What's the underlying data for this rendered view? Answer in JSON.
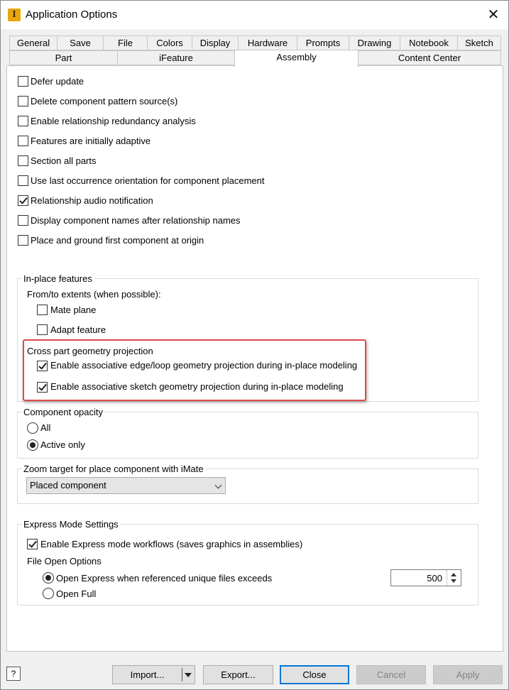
{
  "window": {
    "title": "Application Options",
    "app_icon_letter": "I"
  },
  "tabs": {
    "row1": [
      "General",
      "Save",
      "File",
      "Colors",
      "Display",
      "Hardware",
      "Prompts",
      "Drawing",
      "Notebook",
      "Sketch"
    ],
    "row2": [
      "Part",
      "iFeature",
      "Assembly",
      "Content Center"
    ],
    "active": "Assembly"
  },
  "options": [
    {
      "label": "Defer update",
      "checked": false
    },
    {
      "label": "Delete component pattern source(s)",
      "checked": false
    },
    {
      "label": "Enable relationship redundancy analysis",
      "checked": false
    },
    {
      "label": "Features are initially adaptive",
      "checked": false
    },
    {
      "label": "Section all parts",
      "checked": false
    },
    {
      "label": "Use last occurrence orientation for component placement",
      "checked": false
    },
    {
      "label": "Relationship audio notification",
      "checked": true
    },
    {
      "label": "Display component names after relationship names",
      "checked": false
    },
    {
      "label": "Place and ground first component at origin",
      "checked": false
    }
  ],
  "in_place": {
    "title": "In-place features",
    "extents_label": "From/to extents (when possible):",
    "mate_plane": {
      "label": "Mate plane",
      "checked": false
    },
    "adapt_feature": {
      "label": "Adapt feature",
      "checked": false
    },
    "cross_part_title": "Cross part geometry projection",
    "edge_loop": {
      "label": "Enable associative edge/loop geometry projection during in-place modeling",
      "checked": true
    },
    "sketch_geom": {
      "label": "Enable associative sketch geometry projection during in-place modeling",
      "checked": true
    }
  },
  "opacity": {
    "title": "Component opacity",
    "all": {
      "label": "All",
      "selected": false
    },
    "active_only": {
      "label": "Active only",
      "selected": true
    }
  },
  "zoom": {
    "title": "Zoom target for place component with iMate",
    "selected": "Placed component"
  },
  "express": {
    "title": "Express Mode Settings",
    "enable": {
      "label": "Enable Express mode workflows (saves graphics in assemblies)",
      "checked": true
    },
    "file_open_title": "File Open Options",
    "open_express": {
      "label": "Open Express when referenced unique files exceeds",
      "selected": true
    },
    "open_full": {
      "label": "Open Full",
      "selected": false
    },
    "threshold": "500"
  },
  "buttons": {
    "help": "?",
    "import": "Import...",
    "export": "Export...",
    "close": "Close",
    "cancel": "Cancel",
    "apply": "Apply"
  },
  "colors": {
    "highlight": "#e04b4b",
    "primary_border": "#0078d7",
    "app_icon": "#e9a50c"
  }
}
